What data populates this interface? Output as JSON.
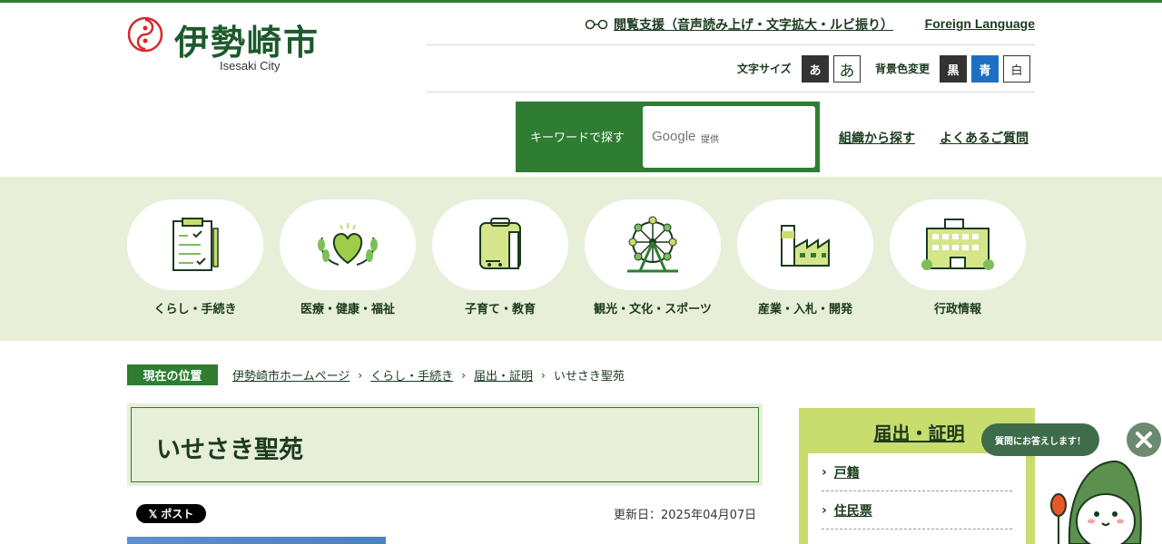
{
  "site": {
    "name": "伊勢崎市",
    "name_en": "Isesaki City"
  },
  "header": {
    "accessibility_link": "閲覧支援（音声読み上げ・文字拡大・ルビ振り）",
    "foreign_link": "Foreign Language",
    "font_size_label": "文字サイズ",
    "font_size_small": "あ",
    "font_size_large": "あ",
    "bg_color_label": "背景色変更",
    "bg_black": "黒",
    "bg_blue": "青",
    "bg_white": "白",
    "search_label": "キーワードで探す",
    "search_brand": "Google",
    "search_brand_note": "提供",
    "org_link": "組織から探す",
    "faq_link": "よくあるご質問"
  },
  "categories": [
    {
      "label": "くらし・手続き",
      "icon": "clipboard-icon"
    },
    {
      "label": "医療・健康・福祉",
      "icon": "heart-laurel-icon"
    },
    {
      "label": "子育て・教育",
      "icon": "backpack-icon"
    },
    {
      "label": "観光・文化・スポーツ",
      "icon": "ferris-wheel-icon"
    },
    {
      "label": "産業・入札・開発",
      "icon": "factory-icon"
    },
    {
      "label": "行政情報",
      "icon": "city-hall-icon"
    }
  ],
  "breadcrumb": {
    "tag": "現在の位置",
    "items": [
      "伊勢崎市ホームページ",
      "くらし・手続き",
      "届出・証明"
    ],
    "current": "いせさき聖苑"
  },
  "page": {
    "title": "いせさき聖苑",
    "post_button": "ポスト",
    "updated": "更新日：2025年04月07日"
  },
  "side_nav": {
    "title": "届出・証明",
    "items": [
      "戸籍",
      "住民票"
    ]
  },
  "assistant": {
    "bubble": "質問にお答えします！"
  },
  "colors": {
    "brand": "#2e7d32",
    "band": "#e7efd9",
    "side": "#c9dc6e",
    "blue": "#1e6fc4"
  }
}
